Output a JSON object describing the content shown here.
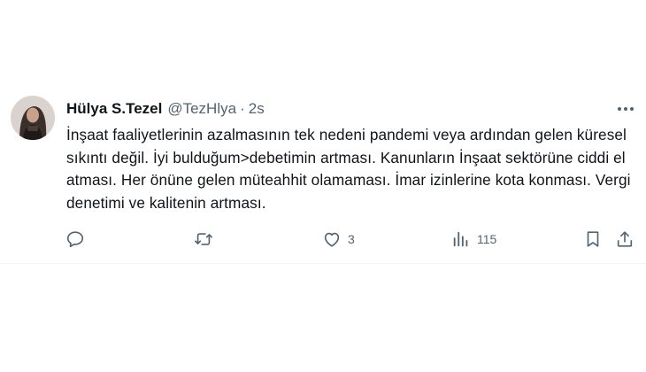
{
  "tweet": {
    "author_name": "Hülya S.Tezel",
    "handle": "@TezHlya",
    "separator": "·",
    "time": "2s",
    "text": "İnşaat faaliyetlerinin azalmasının tek nedeni pandemi veya ardından gelen küresel sıkıntı değil. İyi bulduğum>debetimin artması. Kanunların İnşaat sektörüne ciddi el atması. Her önüne gelen müteahhit olamaması. İmar izinlerine kota konması. Vergi denetimi ve kalitenin artması.",
    "actions": {
      "reply": {
        "icon": "reply-icon",
        "count": ""
      },
      "retweet": {
        "icon": "retweet-icon",
        "count": ""
      },
      "like": {
        "icon": "heart-icon",
        "count": "3"
      },
      "views": {
        "icon": "views-icon",
        "count": "115"
      },
      "bookmark": {
        "icon": "bookmark-icon"
      },
      "share": {
        "icon": "share-icon"
      }
    }
  },
  "colors": {
    "text": "#0f1419",
    "secondary": "#536471",
    "border": "#eff3f4"
  }
}
